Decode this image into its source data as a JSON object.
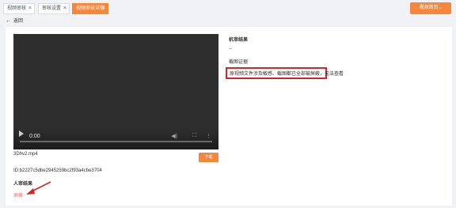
{
  "tabs": [
    {
      "label": "视频审核",
      "active": false
    },
    {
      "label": "审核设置",
      "active": false
    },
    {
      "label": "视频审核详情",
      "active": true
    }
  ],
  "tab_close_glyph": "×",
  "header_button": {
    "label": "视频首页",
    "icon": "chevron-down-icon"
  },
  "back": {
    "label": "返回"
  },
  "player": {
    "time": "0:00"
  },
  "video": {
    "filename": "3Dhv2.mp4",
    "download_label": "下载",
    "id_text": "ID:b2227c5dbe2945259bc2f93a4cbe3704"
  },
  "manual_review": {
    "title": "人审结果",
    "value": "屏蔽"
  },
  "machine_review": {
    "title": "机审结果",
    "value": "--"
  },
  "evidence": {
    "title": "截图证据",
    "text": "原视频文件涉及敏感、截图都已全部被屏蔽，无法查看"
  },
  "colors": {
    "accent": "#f5863a",
    "danger": "#f56c6c",
    "highlight_border": "#e02020"
  }
}
